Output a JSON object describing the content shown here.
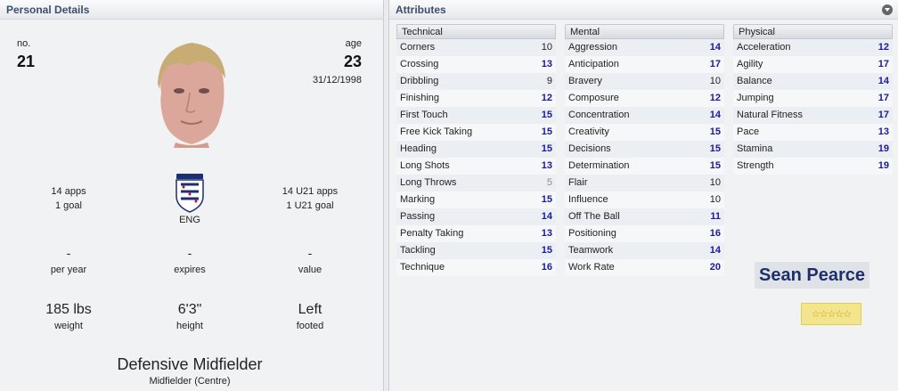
{
  "personal": {
    "header": "Personal Details",
    "no_label": "no.",
    "no_value": "21",
    "age_label": "age",
    "age_value": "23",
    "dob": "31/12/1998",
    "apps": "14 apps",
    "goals": "1 goal",
    "nation": "ENG",
    "u21_apps": "14 U21 apps",
    "u21_goals": "1 U21 goal",
    "wage_value": "-",
    "wage_label": "per year",
    "expires_value": "-",
    "expires_label": "expires",
    "value_value": "-",
    "value_label": "value",
    "weight_value": "185 lbs",
    "weight_label": "weight",
    "height_value": "6'3\"",
    "height_label": "height",
    "foot_value": "Left",
    "foot_label": "footed",
    "position_main": "Defensive Midfielder",
    "position_detail": "Midfielder (Centre)"
  },
  "attributes": {
    "header": "Attributes",
    "technical": {
      "title": "Technical",
      "items": [
        {
          "label": "Corners",
          "value": "10"
        },
        {
          "label": "Crossing",
          "value": "13"
        },
        {
          "label": "Dribbling",
          "value": "9"
        },
        {
          "label": "Finishing",
          "value": "12"
        },
        {
          "label": "First Touch",
          "value": "15"
        },
        {
          "label": "Free Kick Taking",
          "value": "15"
        },
        {
          "label": "Heading",
          "value": "15"
        },
        {
          "label": "Long Shots",
          "value": "13"
        },
        {
          "label": "Long Throws",
          "value": "5"
        },
        {
          "label": "Marking",
          "value": "15"
        },
        {
          "label": "Passing",
          "value": "14"
        },
        {
          "label": "Penalty Taking",
          "value": "13"
        },
        {
          "label": "Tackling",
          "value": "15"
        },
        {
          "label": "Technique",
          "value": "16"
        }
      ]
    },
    "mental": {
      "title": "Mental",
      "items": [
        {
          "label": "Aggression",
          "value": "14"
        },
        {
          "label": "Anticipation",
          "value": "17"
        },
        {
          "label": "Bravery",
          "value": "10"
        },
        {
          "label": "Composure",
          "value": "12"
        },
        {
          "label": "Concentration",
          "value": "14"
        },
        {
          "label": "Creativity",
          "value": "15"
        },
        {
          "label": "Decisions",
          "value": "15"
        },
        {
          "label": "Determination",
          "value": "15"
        },
        {
          "label": "Flair",
          "value": "10"
        },
        {
          "label": "Influence",
          "value": "10"
        },
        {
          "label": "Off The Ball",
          "value": "11"
        },
        {
          "label": "Positioning",
          "value": "16"
        },
        {
          "label": "Teamwork",
          "value": "14"
        },
        {
          "label": "Work Rate",
          "value": "20"
        }
      ]
    },
    "physical": {
      "title": "Physical",
      "items": [
        {
          "label": "Acceleration",
          "value": "12"
        },
        {
          "label": "Agility",
          "value": "17"
        },
        {
          "label": "Balance",
          "value": "14"
        },
        {
          "label": "Jumping",
          "value": "17"
        },
        {
          "label": "Natural Fitness",
          "value": "17"
        },
        {
          "label": "Pace",
          "value": "13"
        },
        {
          "label": "Stamina",
          "value": "19"
        },
        {
          "label": "Strength",
          "value": "19"
        }
      ]
    },
    "player_name": "Sean Pearce",
    "stars": "☆☆☆☆☆"
  },
  "icons": {
    "collapse": "chevron-down-icon",
    "crest": "england-crest-icon",
    "face": "player-photo"
  }
}
